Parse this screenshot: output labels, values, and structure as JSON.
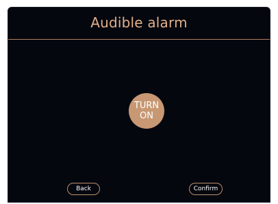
{
  "screen": {
    "title": "Audible alarm",
    "toggle": {
      "line1": "TURN",
      "line2": "ON"
    },
    "buttons": {
      "back": "Back",
      "confirm": "Confirm"
    }
  },
  "colors": {
    "background": "#05070f",
    "accent": "#e2b089",
    "toggle_fill": "#c79873",
    "button_border": "#bc8e6b",
    "text": "#ffffff"
  }
}
